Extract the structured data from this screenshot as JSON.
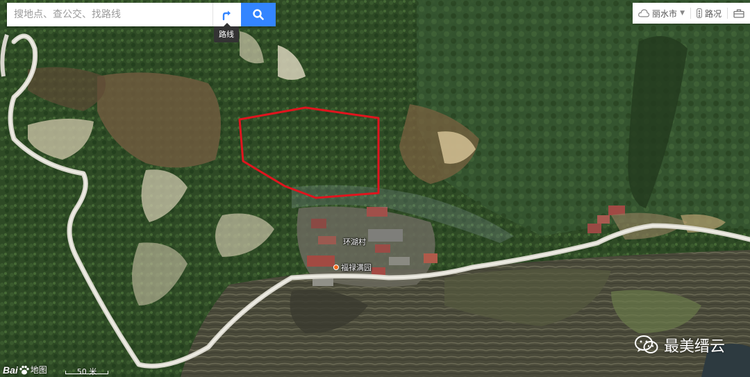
{
  "search": {
    "placeholder": "搜地点、查公交、找路线",
    "route_tooltip": "路线"
  },
  "toolbar": {
    "city": "丽水市",
    "traffic": "路况"
  },
  "labels": {
    "village": "环湖村",
    "poi": "福禄满园"
  },
  "footer": {
    "logo_text": "Bai",
    "logo_suffix": "地图",
    "scale": "50 米"
  },
  "watermark": {
    "text": "最美缙云"
  },
  "colors": {
    "boundary": "#e0141e",
    "accent": "#3385ff"
  }
}
